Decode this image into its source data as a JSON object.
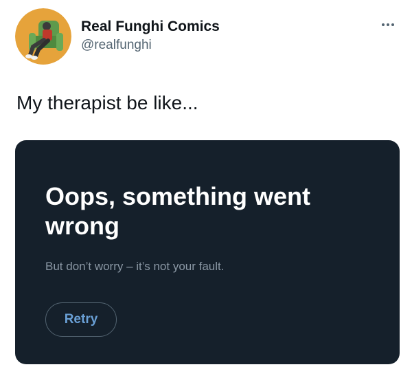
{
  "tweet": {
    "author": {
      "display_name": "Real Funghi Comics",
      "handle": "@realfunghi",
      "avatar_icon": "comic-character-avatar"
    },
    "more_icon": "more-options-icon",
    "text": "My therapist be like..."
  },
  "card": {
    "title": "Oops, something went wrong",
    "subtitle": "But don’t worry – it’s not your fault.",
    "retry_label": "Retry"
  },
  "colors": {
    "card_background": "#15202b",
    "avatar_background": "#e6a33b",
    "retry_text": "#6aa0d6"
  }
}
